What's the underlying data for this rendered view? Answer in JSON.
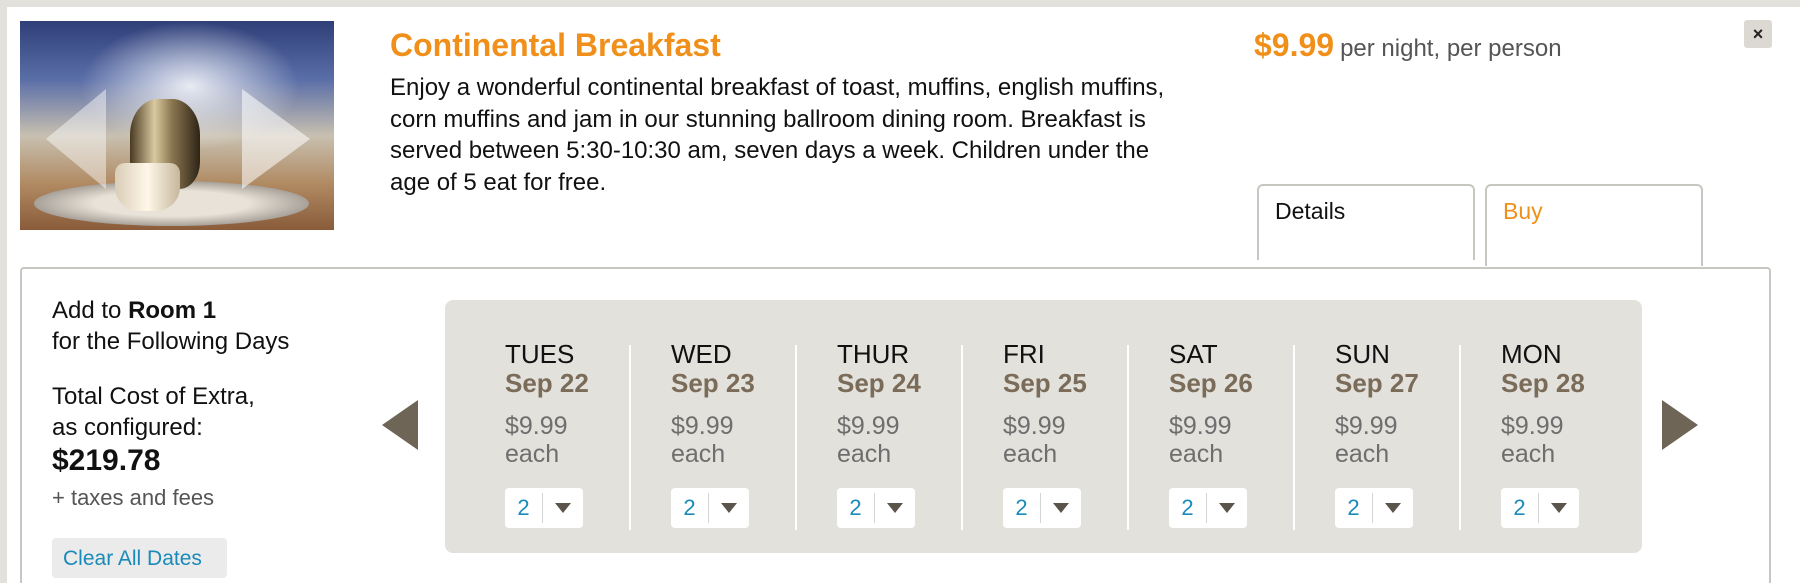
{
  "product": {
    "title": "Continental Breakfast",
    "description": "Enjoy a wonderful continental breakfast of toast, muffins, english muffins, corn muffins and jam in our stunning ballroom dining room. Breakfast is served between 5:30-10:30 am, seven days a week. Children under the age of 5 eat for free.",
    "price": "$9.99",
    "price_unit": "per night, per person",
    "close_label": "×",
    "image_icon": "breakfast-photo"
  },
  "tabs": {
    "details": "Details",
    "buy": "Buy"
  },
  "summary": {
    "add_prefix": "Add to",
    "room": "Room 1",
    "add_suffix": "for the Following Days",
    "total_line1": "Total Cost of Extra,",
    "total_line2": "as configured:",
    "total": "$219.78",
    "taxes": "+ taxes and fees",
    "clear_label": "Clear All Dates"
  },
  "days": [
    {
      "dow": "TUES",
      "date": "Sep 22",
      "price": "$9.99",
      "each": "each",
      "qty": "2"
    },
    {
      "dow": "WED",
      "date": "Sep 23",
      "price": "$9.99",
      "each": "each",
      "qty": "2"
    },
    {
      "dow": "THUR",
      "date": "Sep 24",
      "price": "$9.99",
      "each": "each",
      "qty": "2"
    },
    {
      "dow": "FRI",
      "date": "Sep 25",
      "price": "$9.99",
      "each": "each",
      "qty": "2"
    },
    {
      "dow": "SAT",
      "date": "Sep 26",
      "price": "$9.99",
      "each": "each",
      "qty": "2"
    },
    {
      "dow": "SUN",
      "date": "Sep 27",
      "price": "$9.99",
      "each": "each",
      "qty": "2"
    },
    {
      "dow": "MON",
      "date": "Sep 28",
      "price": "$9.99",
      "each": "each",
      "qty": "2"
    }
  ],
  "colors": {
    "accent": "#f0901a",
    "link": "#1a8ab8",
    "date_text": "#7a6c58",
    "panel_bg": "#e3e1dc"
  }
}
